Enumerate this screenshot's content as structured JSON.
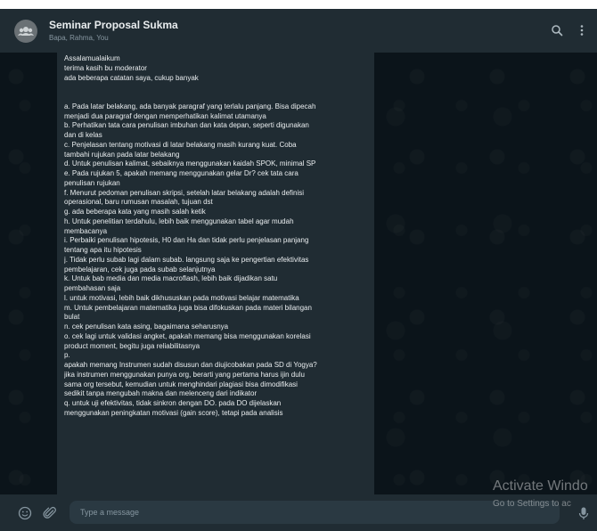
{
  "header": {
    "title": "Seminar Proposal Sukma",
    "subtitle": "Bapa, Rahma, You",
    "icons": [
      "group-avatar-icon",
      "search-icon",
      "menu-icon"
    ]
  },
  "message": {
    "lines": [
      "Assalamualaikum",
      "terima kasih bu moderator",
      "ada beberapa catatan saya, cukup banyak",
      "",
      "",
      "a. Pada latar belakang, ada banyak paragraf yang terlalu panjang. Bisa dipecah",
      "menjadi dua paragraf dengan memperhatikan kalimat utamanya",
      "b. Perhatikan tata cara penulisan imbuhan dan kata depan, seperti digunakan",
      "dan di kelas",
      "c. Penjelasan tentang motivasi di latar belakang masih kurang kuat. Coba",
      "tambahi rujukan pada latar belakang",
      "d. Untuk penulisan kalimat, sebaiknya menggunakan kaidah SPOK, minimal SP",
      "e. Pada rujukan 5, apakah memang menggunakan gelar Dr? cek tata cara",
      "penulisan rujukan",
      "f. Menurut pedoman penulisan skripsi, setelah latar belakang adalah definisi",
      "operasional, baru rumusan masalah, tujuan dst",
      "g. ada beberapa kata yang masih salah ketik",
      "h. Untuk penelitian terdahulu, lebih baik menggunakan tabel agar mudah",
      "membacanya",
      "i. Perbaiki penulisan hipotesis, H0 dan Ha dan tidak perlu penjelasan panjang",
      "tentang apa itu hipotesis",
      "j. Tidak perlu subab lagi dalam subab. langsung saja ke pengertian efektivitas",
      "pembelajaran, cek juga pada subab selanjutnya",
      "k. Untuk bab media dan media macroflash, lebih baik dijadikan satu",
      "pembahasan saja",
      "l. untuk motivasi, lebih baik dikhususkan pada motivasi belajar matematika",
      "m. Untuk pembelajaran matematika juga bisa difokuskan pada materi bilangan",
      "bulat",
      "n. cek penulisan kata asing, bagaimana seharusnya",
      "o. cek lagi untuk validasi angket, apakah memang bisa menggunakan korelasi",
      "product moment, begitu juga reliabilitasnya",
      "p.",
      "apakah memang Instrumen sudah disusun dan diujicobakan pada SD di Yogya?",
      "jika instrumen menggunakan punya org, berarti yang pertama harus ijin dulu",
      "sama org tersebut, kemudian untuk menghindari plagiasi bisa dimodifikasi",
      "sedikit tanpa mengubah makna dan melenceng dari indikator",
      "q. untuk uji efektivitas, tidak sinkron dengan DO. pada DO dijelaskan",
      "menggunakan peningkatan motivasi (gain score), tetapi pada analisis"
    ]
  },
  "composer": {
    "placeholder": "Type a message",
    "icons": [
      "emoji-icon",
      "attach-icon",
      "mic-icon"
    ]
  },
  "watermark": {
    "title": "Activate Windo",
    "subtitle": "Go to Settings to ac"
  },
  "colors": {
    "app_background": "#0b141a",
    "panel": "#202c33",
    "input": "#2a3942",
    "text_primary": "#e9edef",
    "text_secondary": "#8696a0"
  }
}
